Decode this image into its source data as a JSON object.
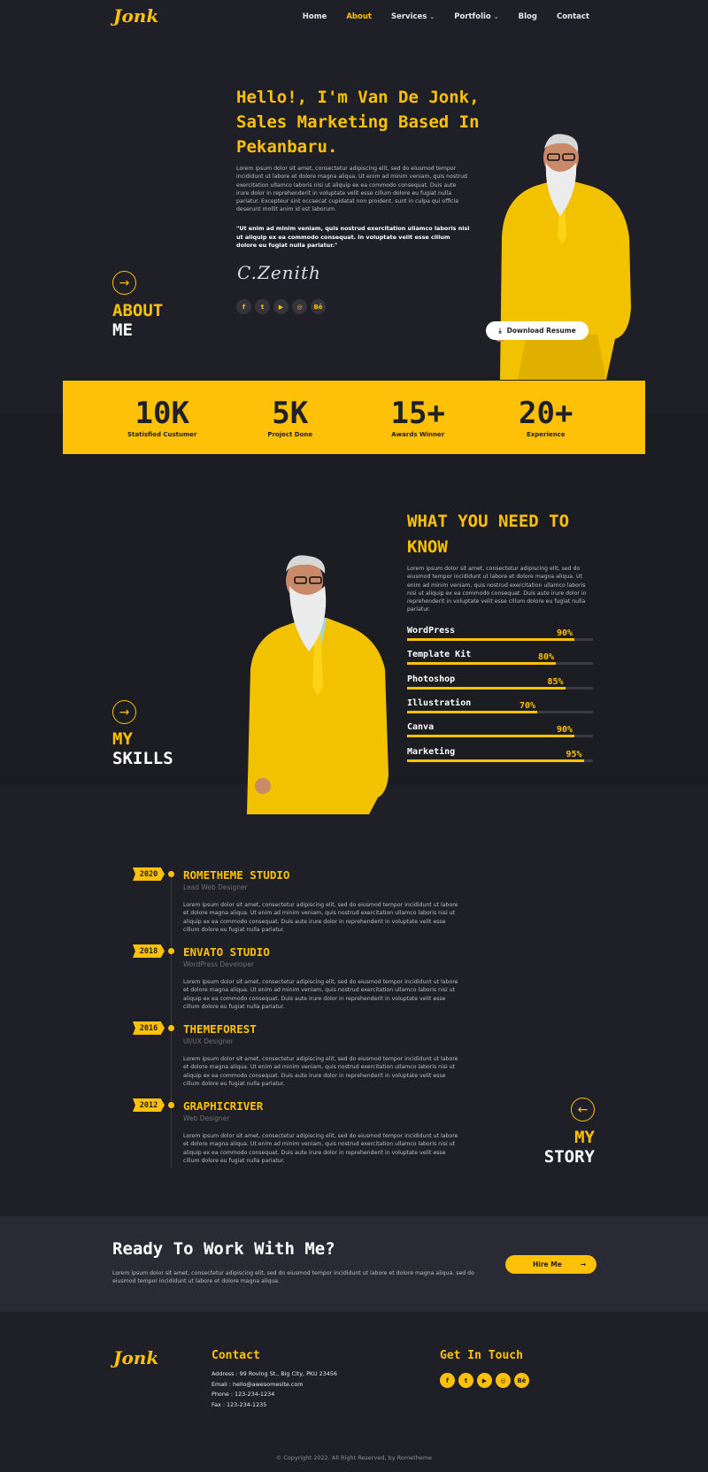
{
  "brand": {
    "logo": "Jonk"
  },
  "nav": {
    "items": [
      {
        "label": "Home",
        "active": false,
        "dropdown": false
      },
      {
        "label": "About",
        "active": true,
        "dropdown": false
      },
      {
        "label": "Services",
        "active": false,
        "dropdown": true
      },
      {
        "label": "Portfolio",
        "active": false,
        "dropdown": true
      },
      {
        "label": "Blog",
        "active": false,
        "dropdown": false
      },
      {
        "label": "Contact",
        "active": false,
        "dropdown": false
      }
    ]
  },
  "hero": {
    "title": "Hello!, I'm Van De Jonk, Sales Marketing Based In Pekanbaru.",
    "body": "Lorem ipsum dolor sit amet, consectetur adipiscing elit, sed do eiusmod tempor incididunt ut labore et dolore magna aliqua. Ut enim ad minim veniam, quis nostrud exercitation ullamco laboris nisi ut aliquip ex ea commodo consequat. Duis aute irure dolor in reprehenderit in voluptate velit esse cillum dolore eu fugiat nulla pariatur. Excepteur sint occaecat cupidatat non proident, sunt in culpa qui officia deserunt mollit anim id est laborum.",
    "quote": "\"Ut enim ad minim veniam, quis nostrud exercitation ullamco laboris nisi ut aliquip ex ea commodo consequat. In voluptate velit esse cillum dolore eu fugiat nulla pariatur.\"",
    "signature": "C.Zenith",
    "download_label": "Download Resume",
    "section_label_1": "ABOUT",
    "section_label_2": "ME",
    "socials": [
      "facebook-icon",
      "twitter-icon",
      "youtube-icon",
      "dribbble-icon",
      "behance-icon"
    ]
  },
  "stats": [
    {
      "value": "10K",
      "label": "Statisfied Custumer"
    },
    {
      "value": "5K",
      "label": "Project Done"
    },
    {
      "value": "15+",
      "label": "Awards Winner"
    },
    {
      "value": "20+",
      "label": "Experience"
    }
  ],
  "skills": {
    "title": "WHAT YOU NEED TO KNOW",
    "body": "Lorem ipsum dolor sit amet, consectetur adipiscing elit, sed do eiusmod tempor incididunt ut labore et dolore magna aliqua. Ut enim ad minim veniam, quis nostrud exercitation ullamco laboris nisi ut aliquip ex ea commodo consequat. Duis aute irure dolor in reprehenderit in voluptate velit esse cillum dolore eu fugiat nulla pariatur.",
    "section_label_1": "MY",
    "section_label_2": "SKILLS",
    "items": [
      {
        "name": "WordPress",
        "percent_label": "90%",
        "level": 0.9
      },
      {
        "name": "Template Kit",
        "percent_label": "80%",
        "level": 0.8
      },
      {
        "name": "Photoshop",
        "percent_label": "85%",
        "level": 0.85
      },
      {
        "name": "Illustration",
        "percent_label": "70%",
        "level": 0.7
      },
      {
        "name": "Canva",
        "percent_label": "90%",
        "level": 0.9
      },
      {
        "name": "Marketing",
        "percent_label": "95%",
        "level": 0.95
      }
    ]
  },
  "story": {
    "section_label_1": "MY",
    "section_label_2": "STORY",
    "items": [
      {
        "year": "2020",
        "company": "ROMETHEME STUDIO",
        "role": "Lead Web Designer",
        "desc": "Lorem ipsum dolor sit amet, consectetur adipiscing elit, sed do eiusmod tempor incididunt ut labore et dolore magna aliqua. Ut enim ad minim veniam, quis nostrud exercitation ullamco laboris nisi ut aliquip ex ea commodo consequat. Duis aute irure dolor in reprehenderit in voluptate velit esse cillum dolore eu fugiat nulla pariatur."
      },
      {
        "year": "2018",
        "company": "ENVATO STUDIO",
        "role": "WordPress Developer",
        "desc": "Lorem ipsum dolor sit amet, consectetur adipiscing elit, sed do eiusmod tempor incididunt ut labore et dolore magna aliqua. Ut enim ad minim veniam, quis nostrud exercitation ullamco laboris nisi ut aliquip ex ea commodo consequat. Duis aute irure dolor in reprehenderit in voluptate velit esse cillum dolore eu fugiat nulla pariatur."
      },
      {
        "year": "2016",
        "company": "THEMEFOREST",
        "role": "UI/UX Designer",
        "desc": "Lorem ipsum dolor sit amet, consectetur adipiscing elit, sed do eiusmod tempor incididunt ut labore et dolore magna aliqua. Ut enim ad minim veniam, quis nostrud exercitation ullamco laboris nisi ut aliquip ex ea commodo consequat. Duis aute irure dolor in reprehenderit in voluptate velit esse cillum dolore eu fugiat nulla pariatur."
      },
      {
        "year": "2012",
        "company": "GRAPHICRIVER",
        "role": "Web Designer",
        "desc": "Lorem ipsum dolor sit amet, consectetur adipiscing elit, sed do eiusmod tempor incididunt ut labore et dolore magna aliqua. Ut enim ad minim veniam, quis nostrud exercitation ullamco laboris nisi ut aliquip ex ea commodo consequat. Duis aute irure dolor in reprehenderit in voluptate velit esse cillum dolore eu fugiat nulla pariatur."
      }
    ]
  },
  "cta": {
    "title": "Ready To Work With Me?",
    "body": "Lorem ipsum dolor sit amet, consectetur adipiscing elit, sed do eiusmod tempor incididunt ut labore et dolore magna aliqua. sed do eiusmod tempor incididunt ut labore et dolore magna aliqua.",
    "button": "Hire Me"
  },
  "footer": {
    "logo": "Jonk",
    "contact_title": "Contact",
    "address": "Address : 99 Roving St., Big City, PKU 23456",
    "email": "Email : hello@awesomesite.com",
    "phone": "Phone : 123-234-1234",
    "fax": "Fax : 123-234-1235",
    "touch_title": "Get In Touch",
    "socials": [
      "facebook-icon",
      "twitter-icon",
      "youtube-icon",
      "dribbble-icon",
      "behance-icon"
    ],
    "copyright": "© Copyright 2022. All Right Reserved, by Rometheme"
  },
  "colors": {
    "accent": "#ffc107",
    "background": "#1f1f28",
    "panel": "#2a2a34"
  }
}
